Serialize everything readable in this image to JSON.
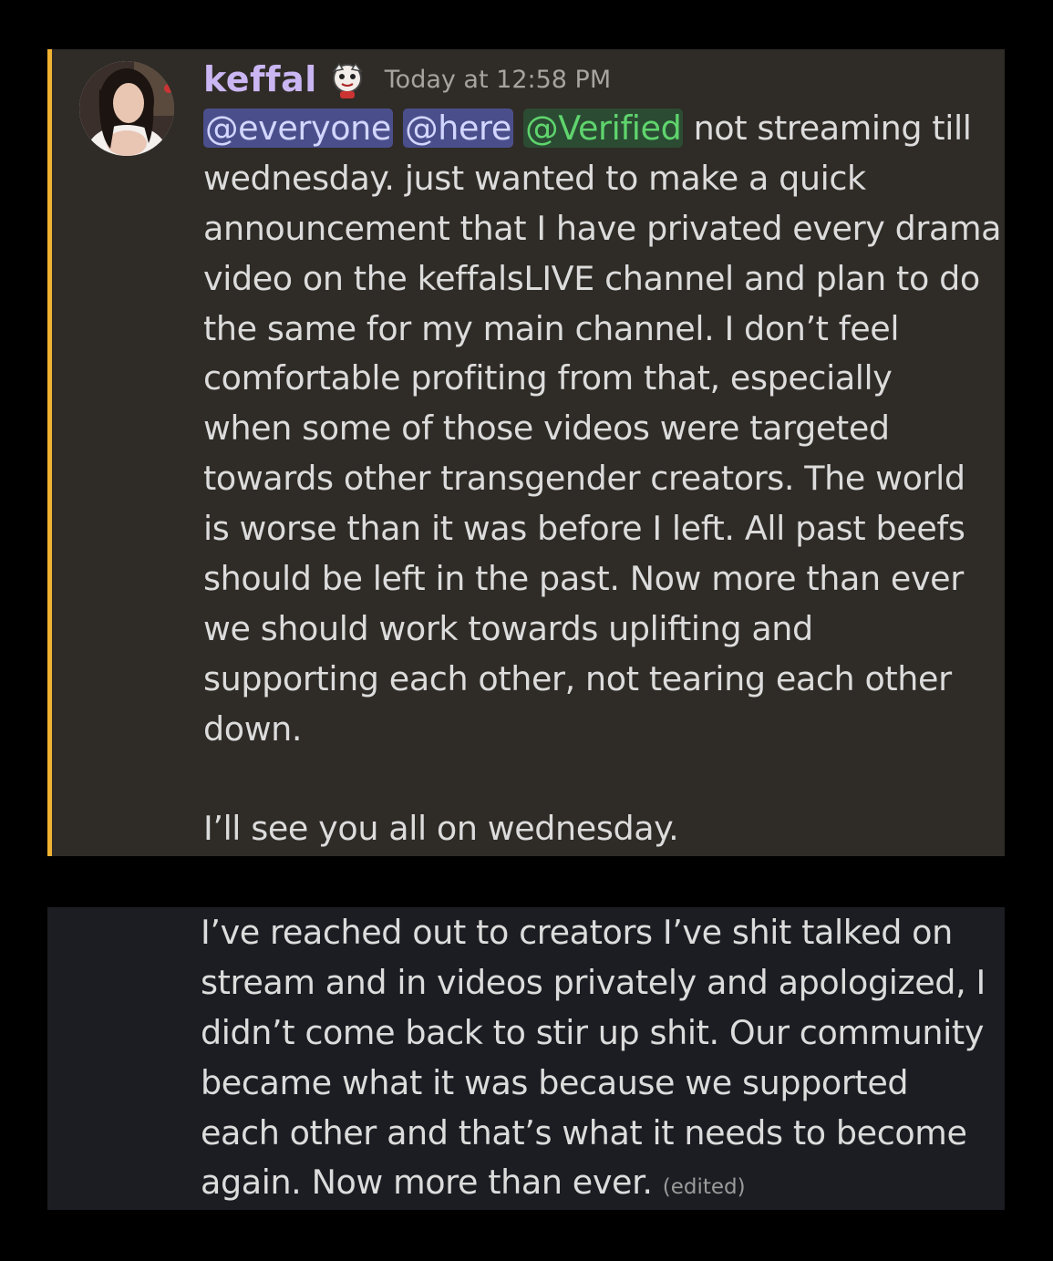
{
  "message": {
    "author": "keffal",
    "timestamp": "Today at 12:58 PM",
    "mentions": [
      "@everyone",
      "@here",
      "@Verified"
    ],
    "lines": [
      " not streaming till",
      "wednesday. just wanted to make a quick",
      "announcement that I have privated every drama",
      "video on the keffalsLIVE channel and plan to do",
      "the same for my main channel. I don’t feel",
      "comfortable profiting from that, especially",
      "when some of those videos were targeted",
      "towards other transgender creators. The world",
      "is worse than it was before I left. All past beefs",
      "should be left in the past. Now more than ever",
      "we should work towards uplifting and",
      "supporting each other, not tearing each other",
      "down.",
      "",
      "I’ll see you all on wednesday."
    ]
  },
  "followup": {
    "lines": [
      "I’ve reached out to creators I’ve shit talked on",
      "stream and in videos privately and apologized, I",
      "didn’t come back to stir up shit. Our community",
      "became what it was because we supported",
      "each other and that’s what it needs to become",
      "again. Now more than ever."
    ],
    "edited_label": "(edited)"
  },
  "colors": {
    "highlight_bar": "#f0b232",
    "username": "#c9b6f2",
    "role_mention": "#5fd46d"
  },
  "icons": [
    "avatar",
    "badge-icon"
  ]
}
